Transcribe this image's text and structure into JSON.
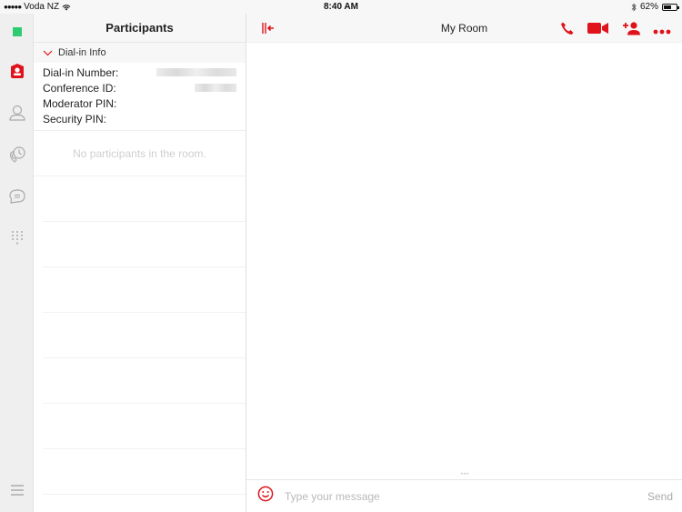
{
  "status_bar": {
    "carrier": "Voda NZ",
    "time": "8:40 AM",
    "battery_percent": "62%",
    "battery_level": 0.62
  },
  "rail": {
    "items": [
      {
        "name": "presence-status",
        "icon": "green-square"
      },
      {
        "name": "rooms",
        "icon": "my-room-icon",
        "active": true
      },
      {
        "name": "contacts",
        "icon": "person-icon"
      },
      {
        "name": "call-history",
        "icon": "phone-clock-icon"
      },
      {
        "name": "chat",
        "icon": "chat-bubble-icon"
      },
      {
        "name": "dialpad",
        "icon": "dialpad-icon"
      },
      {
        "name": "menu",
        "icon": "hamburger-icon"
      }
    ]
  },
  "participants": {
    "title": "Participants",
    "dial_in": {
      "header": "Dial-in Info",
      "rows": [
        {
          "label": "Dial-in Number:",
          "value_obscured": true
        },
        {
          "label": "Conference ID:",
          "value_obscured": true
        },
        {
          "label": "Moderator PIN:",
          "value_obscured": false
        },
        {
          "label": "Security PIN:",
          "value_obscured": false
        }
      ]
    },
    "empty_text": "No participants in the room."
  },
  "chat": {
    "title": "My Room",
    "composer": {
      "placeholder": "Type your message",
      "value": "",
      "send_label": "Send"
    }
  },
  "colors": {
    "accent": "#e0121b",
    "presence": "#2ecc71"
  }
}
